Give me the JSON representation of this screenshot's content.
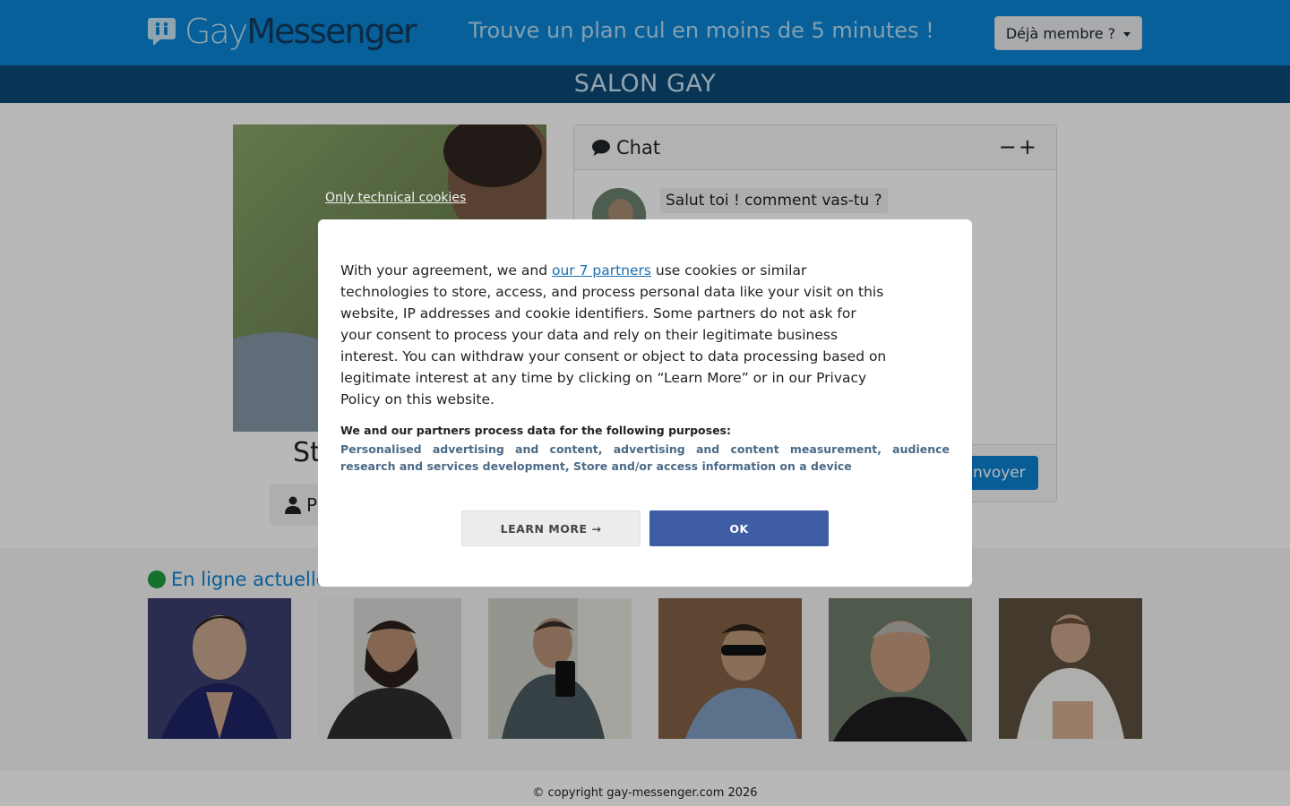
{
  "header": {
    "logo_gay": "Gay",
    "logo_messenger": "Messenger",
    "tagline": "Trouve un plan cul en moins de 5 minutes !",
    "member_button": "Déjà membre ?"
  },
  "banner": {
    "title": "SALON GAY"
  },
  "profile": {
    "name_partial": "St",
    "button_partial": "P"
  },
  "chat": {
    "title": "Chat",
    "controls": "−+",
    "message": "Salut toi ! comment vas-tu ?",
    "send_button": "Envoyer"
  },
  "online": {
    "title_partial": "En ligne actuelle",
    "thumbnails": [
      "user-1",
      "user-2",
      "user-3",
      "user-4",
      "user-5",
      "user-6"
    ]
  },
  "footer": {
    "copyright": "© copyright gay-messenger.com 2026"
  },
  "cookie": {
    "tech_only_link": "Only technical cookies",
    "text_before_link": "With your agreement, we and ",
    "partners_link": "our 7 partners",
    "text_after_link": " use cookies or similar technologies to store, access, and process personal data like your visit on this website, IP addresses and cookie identifiers. Some partners do not ask for your consent to process your data and rely on their legitimate business interest. You can withdraw your consent or object to data processing based on legitimate interest at any time by clicking on “Learn More” or in our Privacy Policy on this website.",
    "purposes_title": "We and our partners process data for the following purposes:",
    "purposes_list": "Personalised advertising and content, advertising and content measurement, audience research and services development, Store and/or access information on a device",
    "learn_more_button": "LEARN MORE →",
    "ok_button": "OK"
  },
  "colors": {
    "brand_blue": "#0a86d6",
    "banner_navy": "#0c4a77",
    "ok_button": "#3e5da4",
    "online_green": "#1e9f3c"
  }
}
